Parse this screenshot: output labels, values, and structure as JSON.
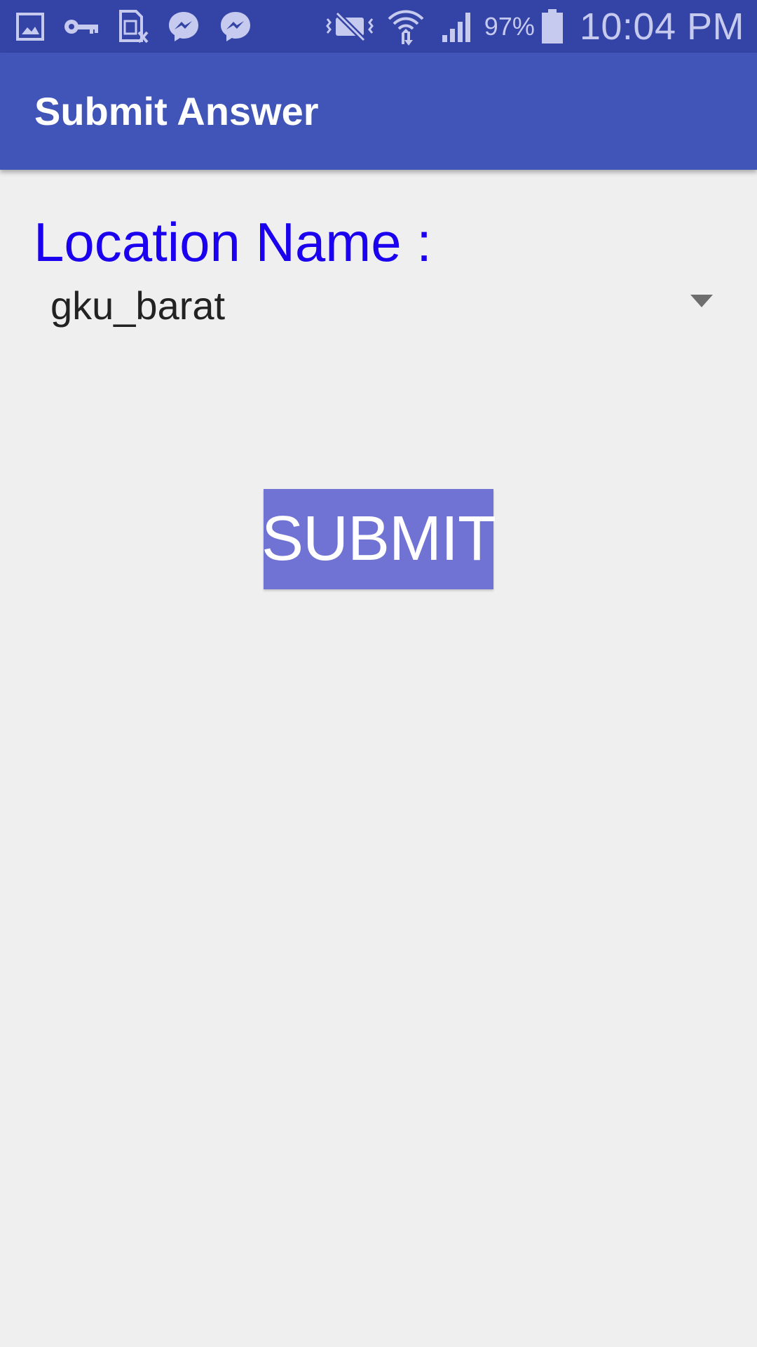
{
  "status_bar": {
    "icons_left": [
      "gallery-icon",
      "vpn-key-icon",
      "sim-error-icon",
      "messenger-icon",
      "messenger-icon"
    ],
    "icons_right": [
      "vibrate-mute-icon",
      "wifi-data-icon",
      "signal-icon"
    ],
    "battery_percent": "97%",
    "battery_level": 0.97,
    "time": "10:04 PM"
  },
  "app_bar": {
    "title": "Submit Answer"
  },
  "form": {
    "location_label": "Location Name :",
    "location_value": "gku_barat"
  },
  "submit_button": {
    "label": "SUBMIT"
  },
  "colors": {
    "status_bar": "#3443A6",
    "app_bar": "#4155B8",
    "label_text": "#1A00EE",
    "button": "#7173D4",
    "background": "#EFEFF0"
  }
}
